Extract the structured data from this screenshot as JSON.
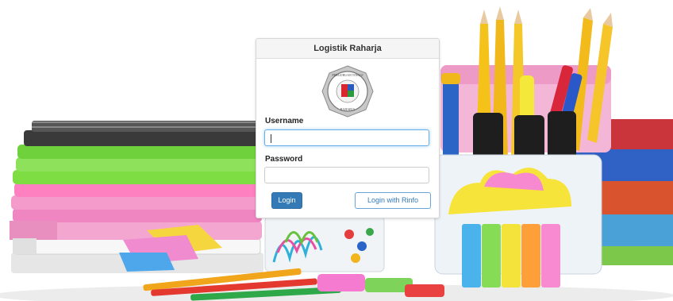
{
  "panel": {
    "title": "Logistik Raharja"
  },
  "logo": {
    "top_text": "PERGURUAN TINGGI",
    "bottom_text": "RAHARJA"
  },
  "form": {
    "username_label": "Username",
    "username_value": "",
    "password_label": "Password",
    "password_value": ""
  },
  "buttons": {
    "login_label": "Login",
    "rinfo_label": "Login with Rinfo"
  },
  "colors": {
    "primary": "#337ab7",
    "focus": "#66afe9",
    "panel_heading": "#f5f5f5"
  }
}
